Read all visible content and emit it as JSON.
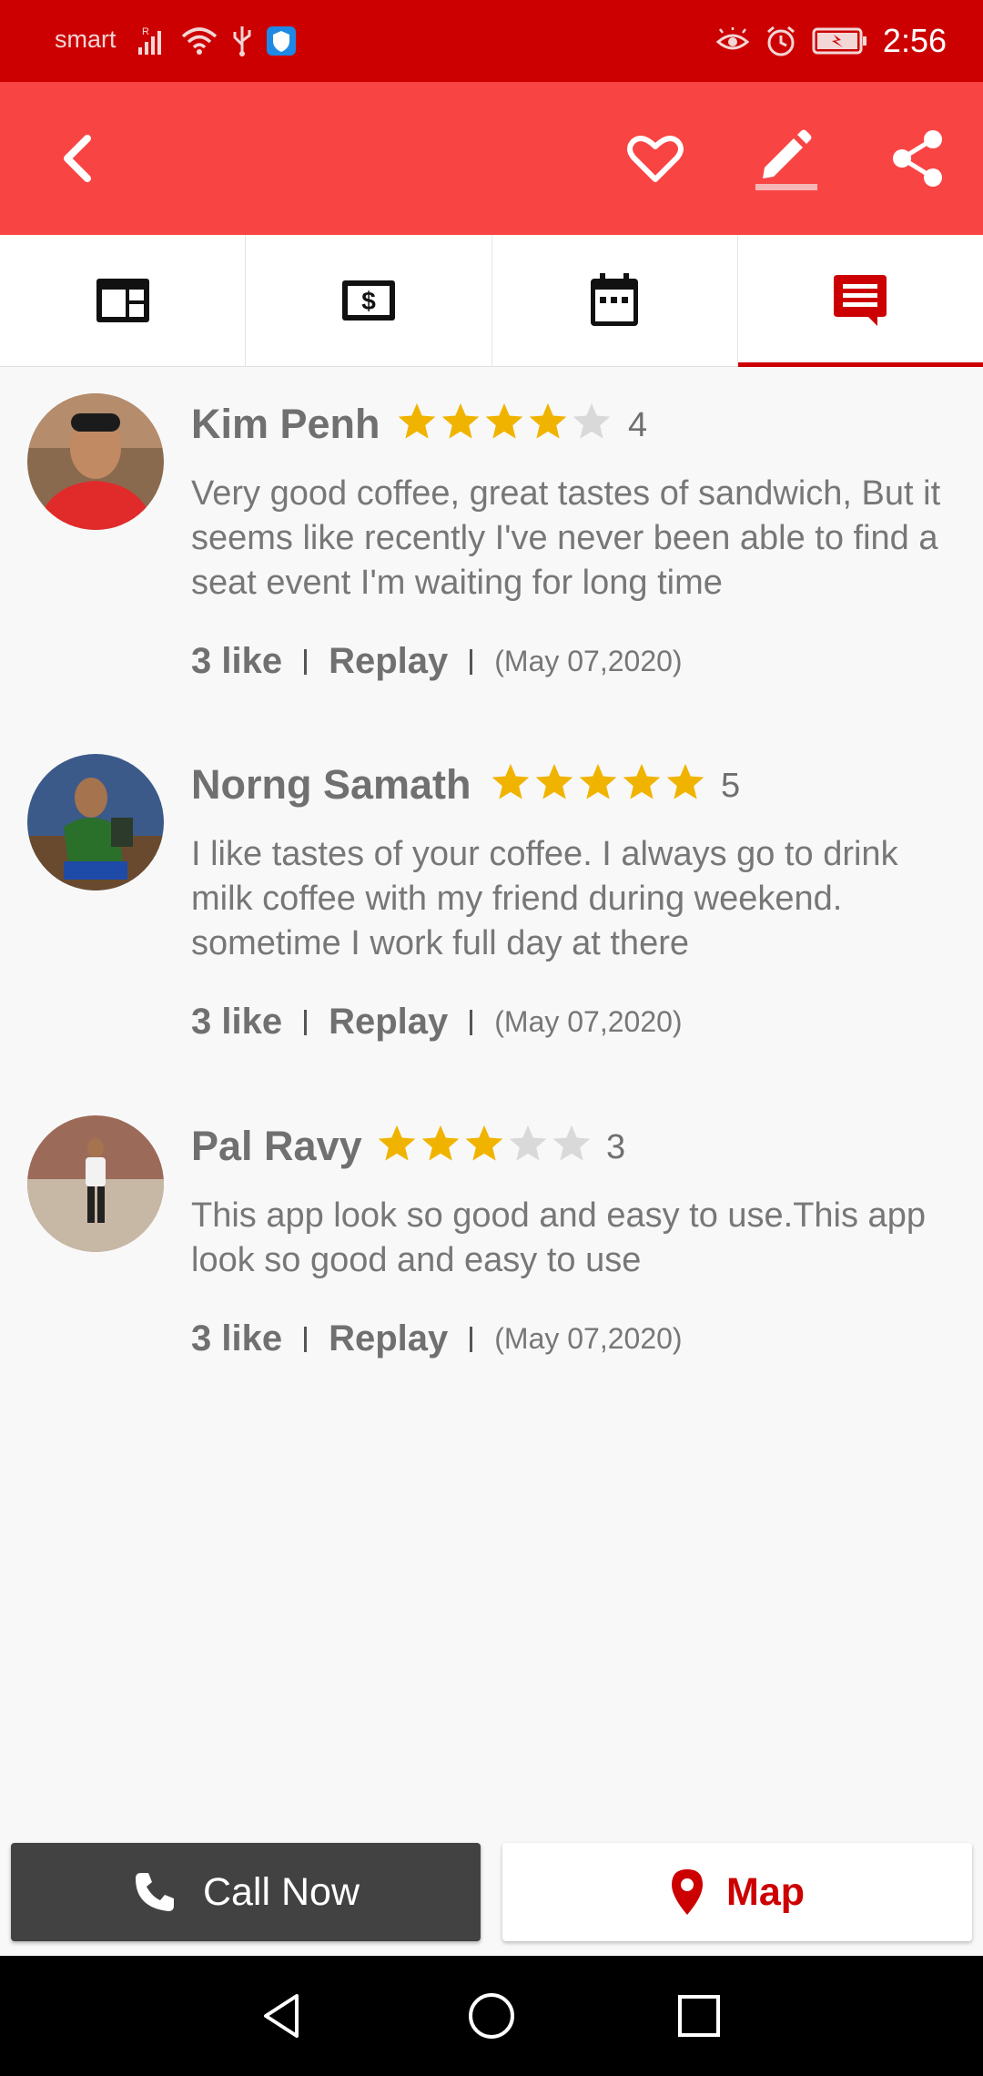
{
  "status_bar": {
    "carrier": "smart",
    "time": "2:56",
    "icons_left": [
      "signal-icon",
      "wifi-icon",
      "usb-icon",
      "shield-app-icon"
    ],
    "icons_right": [
      "eye-comfort-icon",
      "alarm-icon",
      "battery-charging-icon"
    ]
  },
  "app_bar": {
    "icons": [
      "back-arrow-icon",
      "heart-icon",
      "edit-pencil-icon",
      "share-icon"
    ],
    "color": "#f94444"
  },
  "tabs": [
    {
      "icon": "web-layout-icon",
      "active": false
    },
    {
      "icon": "price-tag-icon",
      "active": false
    },
    {
      "icon": "calendar-icon",
      "active": false
    },
    {
      "icon": "comment-icon",
      "active": true
    }
  ],
  "reviews": [
    {
      "name": "Kim Penh",
      "rating": 4,
      "rating_text": "4",
      "text": "Very good coffee, great tastes of sandwich, But it seems like recently I've never been able to find a seat event I'm waiting for long time",
      "likes": "3 like",
      "reply": "Replay",
      "date": "(May 07,2020)"
    },
    {
      "name": "Norng Samath",
      "rating": 5,
      "rating_text": "5",
      "text": "I like tastes of your coffee. I always go to drink milk coffee with my friend during weekend. sometime I work full day at there",
      "likes": "3 like",
      "reply": "Replay",
      "date": "(May 07,2020)"
    },
    {
      "name": "Pal Ravy",
      "rating": 3,
      "rating_text": "3",
      "text": "This app look so good and easy to use.This app look so good and easy to use",
      "likes": "3 like",
      "reply": "Replay",
      "date": "(May 07,2020)"
    }
  ],
  "bottom": {
    "call_label": "Call Now",
    "map_label": "Map"
  },
  "colors": {
    "status_bar": "#cc0000",
    "accent": "#cc0000",
    "star_on": "#f0b400",
    "star_off": "#d9d9d9"
  }
}
